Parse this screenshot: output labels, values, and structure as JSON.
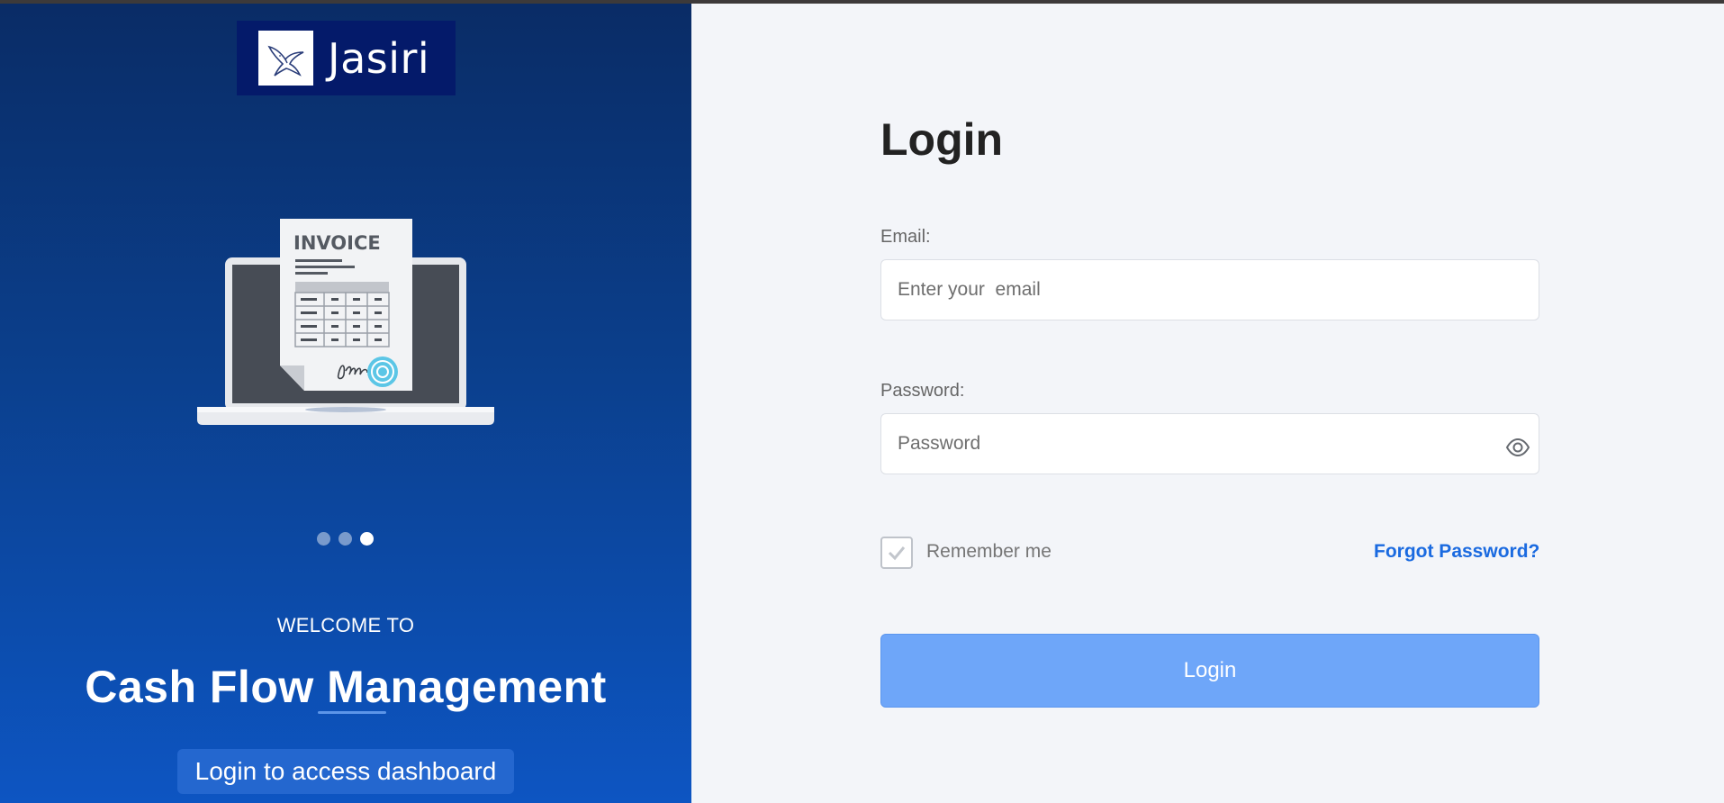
{
  "brand": {
    "name": "Jasiri"
  },
  "carousel": {
    "illustration_text": "INVOICE",
    "slides": [
      {
        "active": false
      },
      {
        "active": false
      },
      {
        "active": true
      }
    ]
  },
  "welcome": {
    "kicker": "WELCOME TO",
    "title": "Cash Flow Management",
    "button_label": "Login to access dashboard"
  },
  "form": {
    "title": "Login",
    "email_label": "Email:",
    "email_placeholder": "Enter your  email",
    "password_label": "Password:",
    "password_placeholder": "Password",
    "remember_label": "Remember me",
    "remember_checked": true,
    "forgot_label": "Forgot Password?",
    "submit_label": "Login"
  },
  "icons": {
    "logo": "eagle-icon",
    "password_toggle": "eye-icon",
    "checkbox": "check-icon"
  },
  "colors": {
    "panel_top": "#0a2c66",
    "panel_bottom": "#0d55c2",
    "accent": "#1a6ae0",
    "button": "#6ea6f9"
  }
}
